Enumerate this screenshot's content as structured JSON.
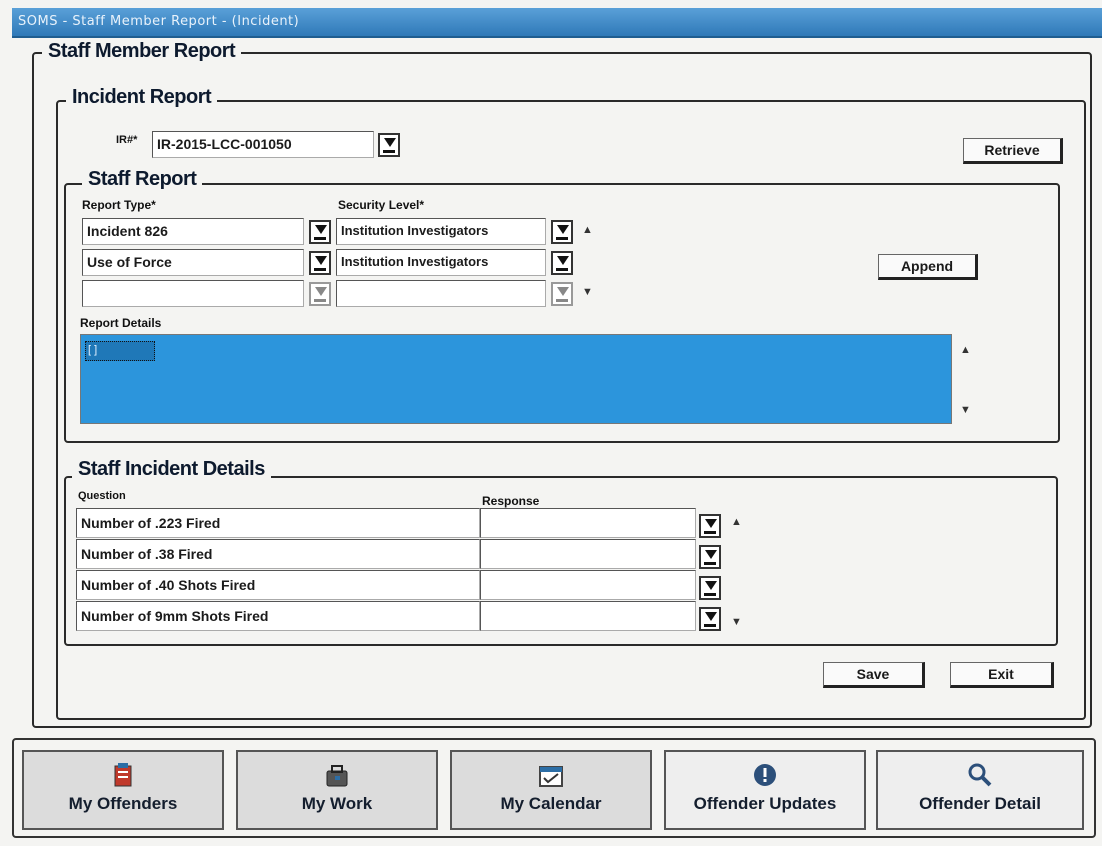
{
  "window": {
    "title": "SOMS - Staff Member Report - (Incident)"
  },
  "staff_member_report": {
    "title": "Staff Member Report"
  },
  "incident_report": {
    "title": "Incident Report",
    "ir_label": "IR#*",
    "ir_value": "IR-2015-LCC-001050",
    "retrieve_label": "Retrieve"
  },
  "staff_report": {
    "title": "Staff Report",
    "report_type_label": "Report Type*",
    "security_level_label": "Security Level*",
    "rows": [
      {
        "report_type": "Incident 826",
        "security_level": "Institution Investigators"
      },
      {
        "report_type": "Use of Force",
        "security_level": "Institution Investigators"
      },
      {
        "report_type": "",
        "security_level": ""
      }
    ],
    "append_label": "Append",
    "report_details_label": "Report Details",
    "report_details_value": "[ ]"
  },
  "staff_incident_details": {
    "title": "Staff Incident Details",
    "question_header": "Question",
    "response_header": "Response",
    "rows": [
      {
        "question": "Number of .223 Fired",
        "response": ""
      },
      {
        "question": "Number of .38 Fired",
        "response": ""
      },
      {
        "question": "Number of .40 Shots Fired",
        "response": ""
      },
      {
        "question": "Number of 9mm Shots Fired",
        "response": ""
      }
    ]
  },
  "actions": {
    "save_label": "Save",
    "exit_label": "Exit"
  },
  "nav": [
    {
      "label": "My Offenders",
      "icon": "offenders-icon"
    },
    {
      "label": "My Work",
      "icon": "work-icon"
    },
    {
      "label": "My Calendar",
      "icon": "calendar-icon"
    },
    {
      "label": "Offender Updates",
      "icon": "alert-icon"
    },
    {
      "label": "Offender Detail",
      "icon": "magnifier-icon"
    }
  ],
  "colors": {
    "titlebar": "#2f79b8",
    "details_highlight": "#2c95dc",
    "frame": "#2a2a2a"
  }
}
